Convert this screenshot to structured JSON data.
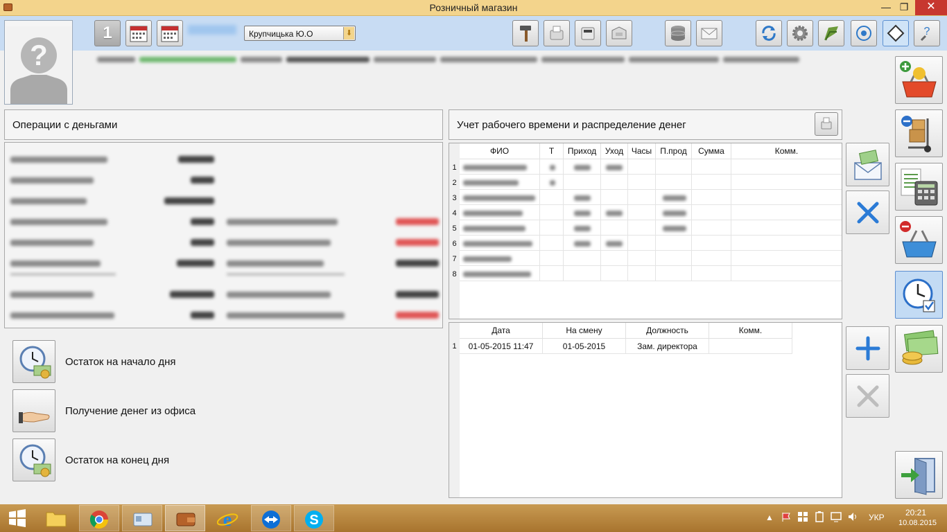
{
  "window": {
    "title": "Розничный магазин",
    "minimize": "—",
    "maximize": "❐",
    "close": "✕"
  },
  "toolbar": {
    "counter": "1",
    "selected_employee": "Крупчицька Ю.О",
    "dropdown_arrow": "⬇"
  },
  "money_panel": {
    "title": "Операции с деньгами"
  },
  "actions": [
    {
      "label": "Остаток на начало дня"
    },
    {
      "label": "Получение денег из офиса"
    },
    {
      "label": "Остаток на конец дня"
    }
  ],
  "worktime_panel": {
    "title": "Учет рабочего времени и распределение денег"
  },
  "worktime_table": {
    "columns": [
      "ФИО",
      "Т",
      "Приход",
      "Уход",
      "Часы",
      "П.прод",
      "Сумма",
      "Комм."
    ],
    "row_numbers": [
      "1",
      "2",
      "3",
      "4",
      "5",
      "6",
      "7",
      "8"
    ]
  },
  "shift_table": {
    "columns": [
      "Дата",
      "На смену",
      "Должность",
      "Комм."
    ],
    "rows": [
      {
        "num": "1",
        "date": "01-05-2015 11:47",
        "shift": "01-05-2015",
        "position": "Зам. директора",
        "comment": ""
      }
    ]
  },
  "taskbar": {
    "language": "УКР",
    "time": "20:21",
    "date": "10.08.2015"
  },
  "colors": {
    "titlebar": "#f3d48c",
    "toolbar": "#c8dcf3",
    "taskbar": "#b8853f",
    "accent_blue": "#2b7bd6"
  }
}
